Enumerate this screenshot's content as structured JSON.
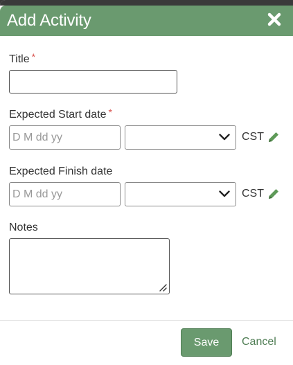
{
  "dialog": {
    "title": "Add Activity",
    "close_icon": "close-icon"
  },
  "fields": {
    "title": {
      "label": "Title",
      "required_mark": "*",
      "value": ""
    },
    "start": {
      "label": "Expected Start date",
      "required_mark": "*",
      "date_placeholder": "D M dd yy",
      "time_value": "",
      "timezone": "CST",
      "edit_icon": "pencil-icon"
    },
    "finish": {
      "label": "Expected Finish date",
      "date_placeholder": "D M dd yy",
      "time_value": "",
      "timezone": "CST",
      "edit_icon": "pencil-icon"
    },
    "notes": {
      "label": "Notes",
      "value": ""
    }
  },
  "footer": {
    "save_label": "Save",
    "cancel_label": "Cancel"
  },
  "colors": {
    "header": "#6a9a6f",
    "accent": "#4f7d54",
    "required": "#d9534f"
  }
}
